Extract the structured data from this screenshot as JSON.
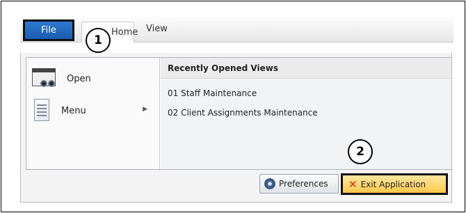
{
  "ribbon": {
    "tabs": [
      {
        "label": "File"
      },
      {
        "label": "Home"
      },
      {
        "label": "View"
      }
    ]
  },
  "callouts": [
    "1",
    "2"
  ],
  "file_menu": {
    "items": [
      {
        "label": "Open",
        "icon": "open-binoculars-icon"
      },
      {
        "label": "Menu",
        "icon": "menu-page-icon",
        "submenu_arrow": "▶"
      }
    ],
    "recent": {
      "heading": "Recently Opened Views",
      "items": [
        "01 Staff Maintenance",
        "02 Client Assignments Maintenance"
      ]
    },
    "buttons": {
      "preferences": "Preferences",
      "exit": "Exit Application"
    }
  },
  "colors": {
    "file_tab": "#1a5cb0",
    "exit_highlight": "#ffc94a",
    "exit_icon": "#d42a1f"
  }
}
